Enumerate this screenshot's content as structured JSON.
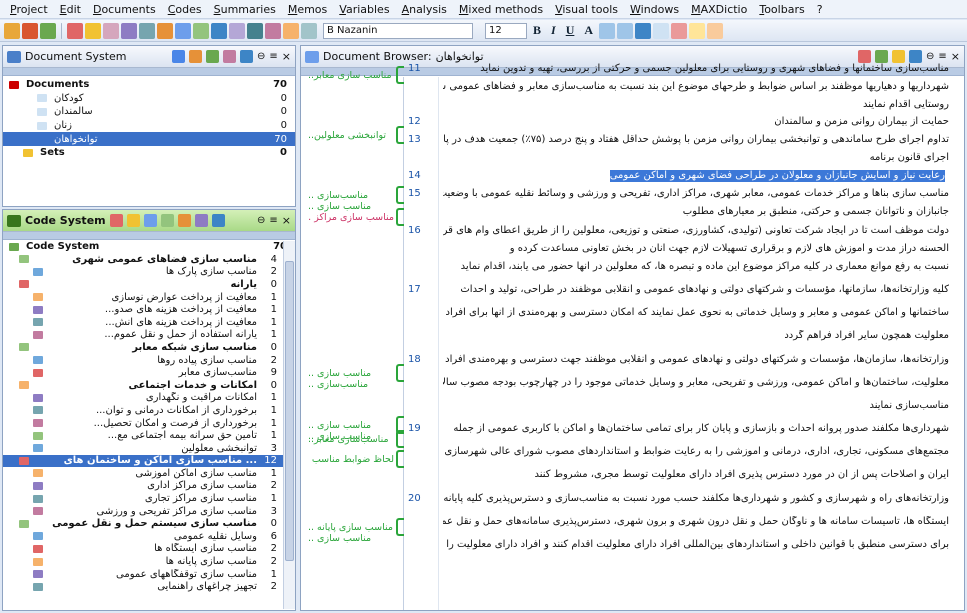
{
  "menu": [
    "Project",
    "Edit",
    "Documents",
    "Codes",
    "Summaries",
    "Memos",
    "Variables",
    "Analysis",
    "Mixed methods",
    "Visual tools",
    "Windows",
    "MAXDictio",
    "Toolbars",
    "?"
  ],
  "toolbar": {
    "font": "B Nazanin",
    "size": "12",
    "format_labels": [
      "B",
      "I",
      "U",
      "A"
    ]
  },
  "doc_system": {
    "title": "Document System",
    "items": [
      {
        "label": "Documents",
        "count": "70"
      },
      {
        "label": "کودکان",
        "count": "0"
      },
      {
        "label": "سالمندان",
        "count": "0"
      },
      {
        "label": "زنان",
        "count": "0"
      },
      {
        "label": "توانخواهان",
        "count": "70"
      },
      {
        "label": "Sets",
        "count": "0"
      }
    ]
  },
  "code_system": {
    "title": "Code System",
    "root": {
      "label": "Code System",
      "count": "70"
    },
    "items": [
      {
        "label": "مناسب سازی فضاهای عمومی شهری",
        "count": "4"
      },
      {
        "label": "مناسب سازی پارک ها",
        "count": "2"
      },
      {
        "label": "یارانه",
        "count": "0"
      },
      {
        "label": "معافیت از پرداخت عوارض نوسازی",
        "count": "1"
      },
      {
        "label": "معافیت از پرداخت هزینه های صدو...",
        "count": "1"
      },
      {
        "label": "معافیت از پرداخت هزینه های انش...",
        "count": "1"
      },
      {
        "label": "یارانه استفاده از حمل و نقل عموم...",
        "count": "1"
      },
      {
        "label": "مناسب سازی شبکه معابر",
        "count": "0"
      },
      {
        "label": "مناسب سازی پیاده روها",
        "count": "2"
      },
      {
        "label": "مناسب‌سازی معابر",
        "count": "9"
      },
      {
        "label": "امکانات و خدمات اجتماعی",
        "count": "0"
      },
      {
        "label": "امکانات مراقبت و نگهداری",
        "count": "1"
      },
      {
        "label": "برخورداری از امکانات درمانی و توان...",
        "count": "1"
      },
      {
        "label": "برخورداری از فرصت و امکان تحصیل...",
        "count": "1"
      },
      {
        "label": "تأمین حق سرانه بیمه اجتماعی مع...",
        "count": "1"
      },
      {
        "label": "توانبخشی معلولین",
        "count": "3"
      },
      {
        "label": "... مناسب سازی اماکن و ساختمان های",
        "count": "12"
      },
      {
        "label": "مناسب سازی اماکن آموزشی",
        "count": "1"
      },
      {
        "label": "مناسب سازی مراکز اداری",
        "count": "2"
      },
      {
        "label": "مناسب سازی مراکز تجاری",
        "count": "1"
      },
      {
        "label": "مناسب سازی مراکز تفریحی و ورزشی",
        "count": "3"
      },
      {
        "label": "مناسب سازی سیستم حمل و نقل عمومی",
        "count": "0"
      },
      {
        "label": "وسایل نقلیه عمومی",
        "count": "6"
      },
      {
        "label": "مناسب سازی ایستگاه ها",
        "count": "2"
      },
      {
        "label": "مناسب سازی پایانه ها",
        "count": "2"
      },
      {
        "label": "مناسب سازی توقفگاههای عمومی",
        "count": "1"
      },
      {
        "label": "تجهیز چراغهای راهنمایی",
        "count": "2"
      }
    ]
  },
  "browser": {
    "title": "Document Browser:",
    "doc_name": "توانخواهان",
    "codes": [
      {
        "label": "مناسب سازی معابر..",
        "extra": ""
      },
      {
        "label": "توانبخشی معلولین..",
        "extra": ""
      },
      {
        "label": "مناسب‌سازی ..",
        "extra": "مناسب سازی .."
      },
      {
        "label": "مناسب سازی مراکز ..",
        "extra": ""
      },
      {
        "label": "مناسب سازی ..",
        "extra": "مناسب‌سازی .."
      },
      {
        "label": "مناسب سازی ..",
        "extra": "مناسب سازی .."
      },
      {
        "label": "مناسب‌سازی معابر..",
        "extra": ""
      },
      {
        "label": "لحاظ ضوابط مناسب ..",
        "extra": ""
      },
      {
        "label": "مناسب سازی پایانه ..",
        "extra": "مناسب سازی .."
      }
    ],
    "line_numbers": [
      "11",
      "12",
      "13",
      "14",
      "15",
      "16",
      "17",
      "18",
      "19",
      "20"
    ],
    "lines": [
      "مناسب‌سازی ساختمانها و فضاهای شهری و روستایی برای معلولین جسمی و حرکتی از بررسی، تهیه و تدوین نماید",
      "شهرداریها و دهیاریها موظفند بر اساس ضوابط و طرحهای موضوع این بند نسبت به مناسب‌سازی معابر و فضاهای عمومی شهری و",
      "روستایی اقدام نمایند",
      "حمایت از بیماران روانی مزمن و سالمندان",
      "تداوم اجرای طرح ساماندهی و توانبخشی بیماران روانی مزمن با پوشش حداقل هفتاد و پنج درصد (۷۵٪) جمعیت هدف در پایان",
      "اجرای قانون برنامه",
      "رعایت نیاز و آسایش جانبازان و معلولان در طراحی فضای شهری و اماکن عمومی",
      "مناسب سازی بناها و مراکز خدمات عمومی، معابر شهری، مراکز اداری، تفریحی و ورزشی و وسائط نقلیه عمومی با وضعیت جسمی",
      "جانبازان و ناتوانان جسمی و حرکتی، منطبق بر معیارهای مطلوب",
      "دولت موظف است تا در ایجاد شرکت تعاونی (تولیدی، کشاورزی، صنعتی و توزیعی، معلولین را از طریق اعطای وام های قرض",
      "الحسنه دراز مدت و آموزش های لازم و برقراری تسهیلات لازم جهت آنان در بخش تعاونی مساعدت کرده و",
      "نسبت به رفع موانع معماری در کلیه مراکز موضوع این ماده و تبصره ها، که معلولین در آنها حضور می یابند، اقدام نماید",
      "کلیه وزارتخانه‌ها، سازمانها، مؤسسات و شرکتهای دولتی و نهادهای عمومی و انقلابی موظفند در طراحی، تولید و احداث",
      "ساختمانها و اماکن عمومی و معابر و وسایل خدماتی به نحوی عمل نمایند که امکان دسترسی و بهره‌مندی از آنها برای افراد دارای",
      "معلولیت همچون سایر افراد فراهم گردد",
      "وزارتخانه‌ها، سازمان‌ها، مؤسسات و شرکتهای دولتی و نهادهای عمومی و انقلابی موظفند جهت دسترسی و بهره‌مندی افراد دارای",
      "معلولیت، ساختمان‌ها و اماکن عمومی، ورزشی و تفریحی، معابر و وسایل خدماتی موجود را در چهارچوب بودجه مصوب سالانه خود",
      "مناسب‌سازی نمایند",
      "شهرداری‌ها مکلفند صدور پروانه احداث و بازسازی و پایان کار برای تمامی ساختمان‌ها و اماکن با کاربری عمومی از جمله",
      "مجتمع‌های مسکونی، تجاری، اداری، درمانی و آموزشی را به رعایت ضوابط و استانداردهای مصوب شورای عالی شهرسازی و معماری",
      "ایران و اصلاحات پس از آن در مورد دسترس پذیری افراد دارای معلولیت توسط مجری، مشروط کنند",
      "وزارتخانه‌های راه و شهرسازی و کشور و شهرداری‌ها مکلفند حسب مورد نسبت به مناسب‌سازی و دسترس‌پذیری کلیه پایانه ها،",
      "ایستگاه ها، تأسیسات سامانه ها و ناوگان حمل و نقل درون شهری و برون شهری، دسترس‌پذیری سامانه‌های حمل و نقل عمومی",
      "برای دسترسی منطبق با قوانین داخلی و استانداردهای بین‌المللی افراد دارای معلولیت اقدام کنند و افراد دارای معلولیت را از"
    ]
  },
  "colors": {
    "accent": "#3a70c8",
    "code_green": "#2aa53a",
    "line_blue": "#1a54a8",
    "highlight": "#3c78d8"
  }
}
